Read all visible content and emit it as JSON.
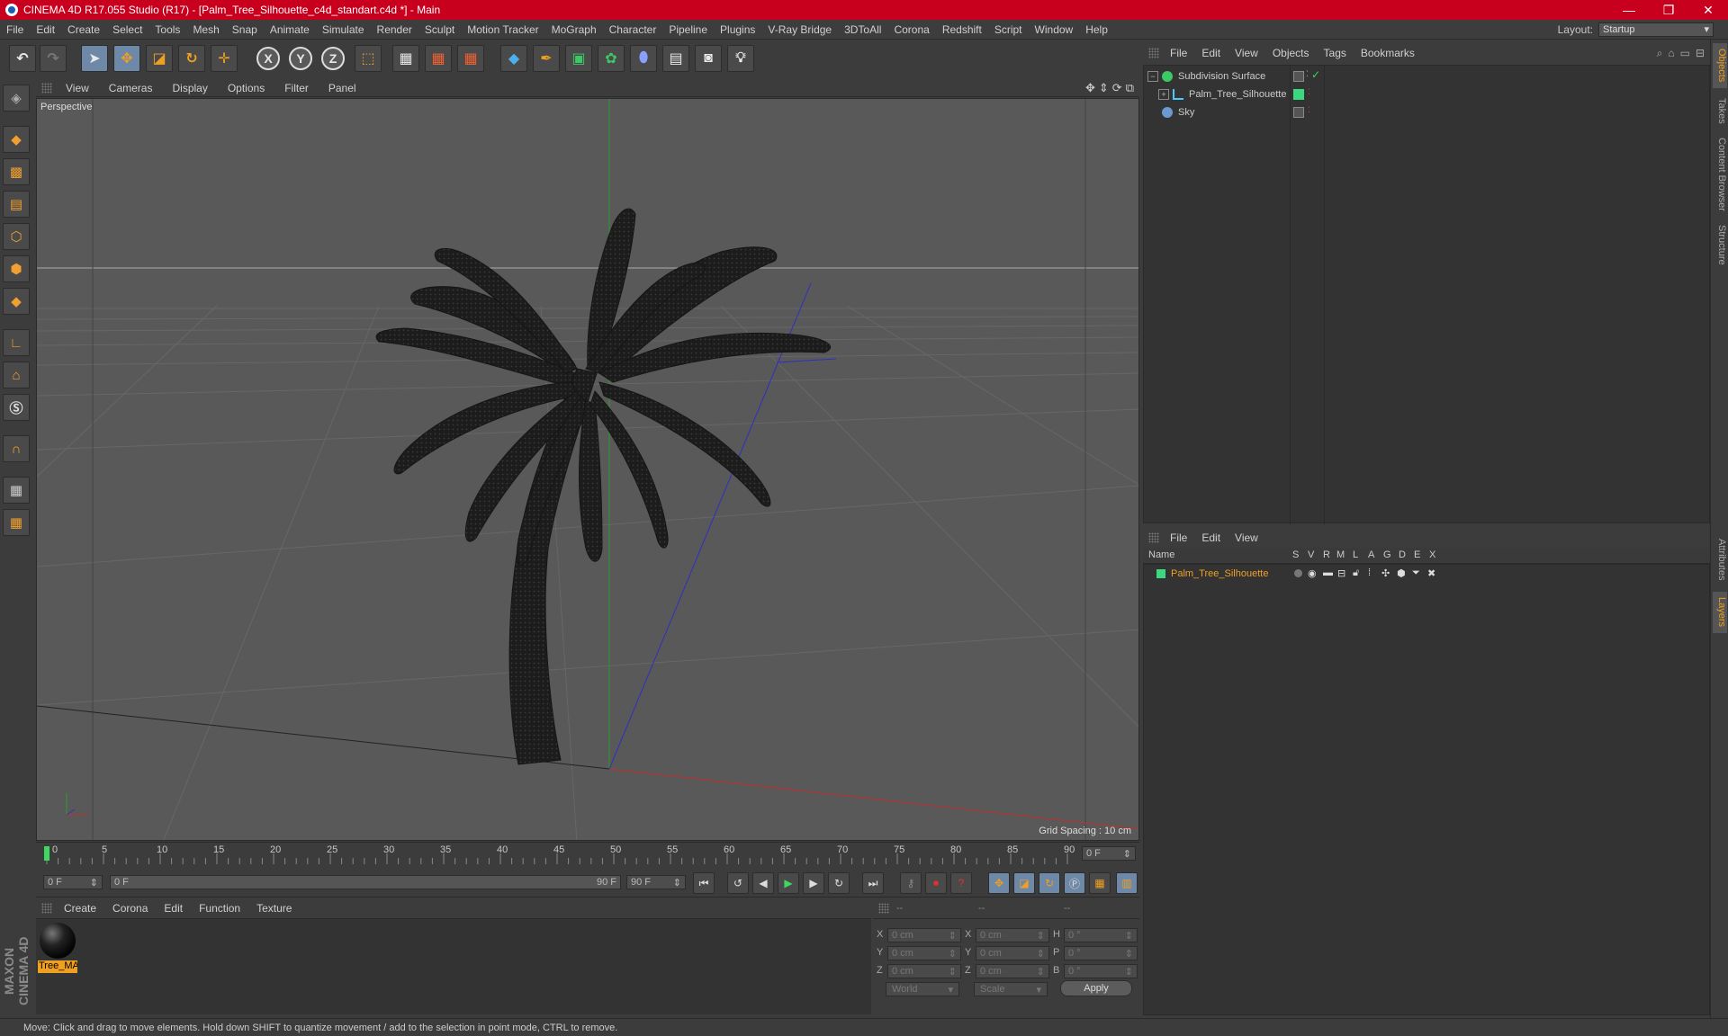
{
  "window": {
    "title": "CINEMA 4D R17.055 Studio (R17) - [Palm_Tree_Silhouette_c4d_standart.c4d *] - Main",
    "minimize": "—",
    "maximize": "❐",
    "close": "✕"
  },
  "menubar": {
    "items": [
      "File",
      "Edit",
      "Create",
      "Select",
      "Tools",
      "Mesh",
      "Snap",
      "Animate",
      "Simulate",
      "Render",
      "Sculpt",
      "Motion Tracker",
      "MoGraph",
      "Character",
      "Pipeline",
      "Plugins",
      "V-Ray Bridge",
      "3DToAll",
      "Corona",
      "Redshift",
      "Script",
      "Window",
      "Help"
    ],
    "layout_label": "Layout:",
    "layout_value": "Startup"
  },
  "toolbar": {
    "axis_x": "X",
    "axis_y": "Y",
    "axis_z": "Z"
  },
  "viewport": {
    "menu": [
      "View",
      "Cameras",
      "Display",
      "Options",
      "Filter",
      "Panel"
    ],
    "label": "Perspective",
    "grid_spacing": "Grid Spacing : 10 cm"
  },
  "timeline": {
    "ticks": [
      "0",
      "5",
      "10",
      "15",
      "20",
      "25",
      "30",
      "35",
      "40",
      "45",
      "50",
      "55",
      "60",
      "65",
      "70",
      "75",
      "80",
      "85",
      "90"
    ],
    "current_frame": "0 F",
    "start_field": "0 F",
    "range_start": "0 F",
    "range_end": "90 F",
    "end_field": "90 F"
  },
  "material_manager": {
    "menu": [
      "Create",
      "Corona",
      "Edit",
      "Function",
      "Texture"
    ],
    "materials": [
      {
        "name": "Tree_MA"
      }
    ]
  },
  "coordinates": {
    "headers": [
      "--",
      "--",
      "--"
    ],
    "rows": [
      {
        "axis": "X",
        "pos": "0 cm",
        "axis2": "X",
        "size": "0 cm",
        "rot_axis": "H",
        "rot": "0 °"
      },
      {
        "axis": "Y",
        "pos": "0 cm",
        "axis2": "Y",
        "size": "0 cm",
        "rot_axis": "P",
        "rot": "0 °"
      },
      {
        "axis": "Z",
        "pos": "0 cm",
        "axis2": "Z",
        "size": "0 cm",
        "rot_axis": "B",
        "rot": "0 °"
      }
    ],
    "world": "World",
    "scale": "Scale",
    "apply": "Apply"
  },
  "object_manager": {
    "menu": [
      "File",
      "Edit",
      "View",
      "Objects",
      "Tags",
      "Bookmarks"
    ],
    "objects": [
      {
        "name": "Subdivision Surface",
        "color": "#3cc864"
      },
      {
        "name": "Palm_Tree_Silhouette",
        "color": "#4ac8ff"
      },
      {
        "name": "Sky",
        "color": "#6a9ad0"
      }
    ]
  },
  "layer_manager": {
    "menu": [
      "File",
      "Edit",
      "View"
    ],
    "columns": [
      "Name",
      "S",
      "V",
      "R",
      "M",
      "L",
      "A",
      "G",
      "D",
      "E",
      "X"
    ],
    "layers": [
      {
        "name": "Palm_Tree_Silhouette",
        "color": "#3cd880"
      }
    ]
  },
  "right_tabs": [
    "Objects",
    "Takes",
    "Content Browser",
    "Structure",
    "Attributes",
    "Layers"
  ],
  "status": "Move: Click and drag to move elements. Hold down SHIFT to quantize movement / add to the selection in point mode, CTRL to remove.",
  "brand": "MAXON CINEMA 4D"
}
